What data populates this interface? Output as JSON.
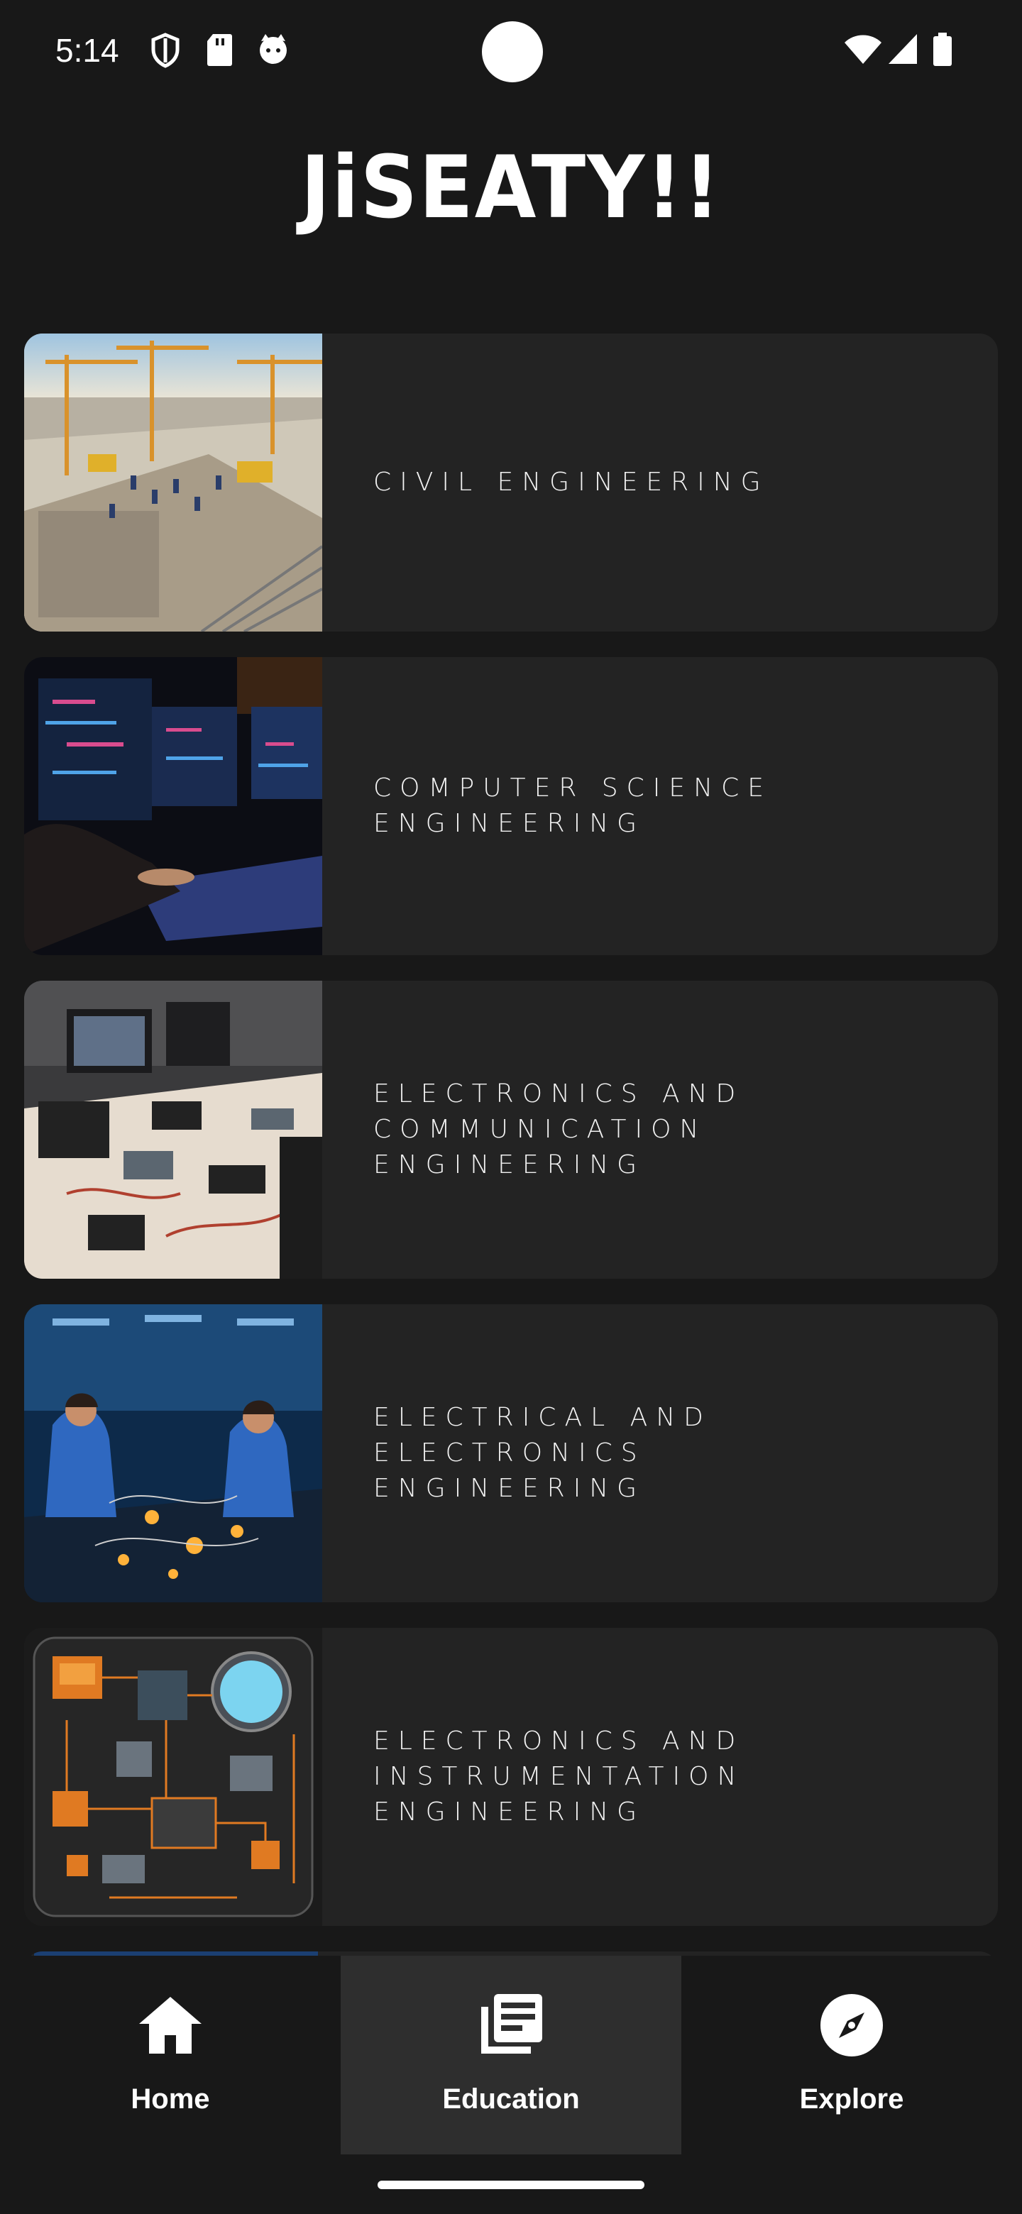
{
  "status": {
    "time": "5:14",
    "icons": [
      "shield-icon",
      "sd-card-icon",
      "cat-icon",
      "wifi-icon",
      "signal-icon",
      "battery-icon"
    ]
  },
  "app": {
    "title": "JiSEATY!!"
  },
  "cards": [
    {
      "lines": [
        "CIVIL ENGINEERING"
      ],
      "image": "construction-site-image"
    },
    {
      "lines": [
        "COMPUTER SCIENCE",
        "ENGINEERING"
      ],
      "image": "computer-workstation-image"
    },
    {
      "lines": [
        "ELECTRONICS AND",
        "COMMUNICATION",
        "ENGINEERING"
      ],
      "image": "electronics-lab-image"
    },
    {
      "lines": [
        "ELECTRICAL AND",
        "ELECTRONICS",
        "ENGINEERING"
      ],
      "image": "electrical-lab-image"
    },
    {
      "lines": [
        "ELECTRONICS AND",
        "INSTRUMENTATION",
        "ENGINEERING"
      ],
      "image": "circuit-board-image"
    }
  ],
  "nav": {
    "items": [
      {
        "label": "Home",
        "icon": "home-icon",
        "active": false
      },
      {
        "label": "Education",
        "icon": "education-icon",
        "active": true
      },
      {
        "label": "Explore",
        "icon": "compass-icon",
        "active": false
      }
    ]
  },
  "colors": {
    "background": "#181818",
    "card": "#232323",
    "active_nav": "#2e2e2e"
  }
}
